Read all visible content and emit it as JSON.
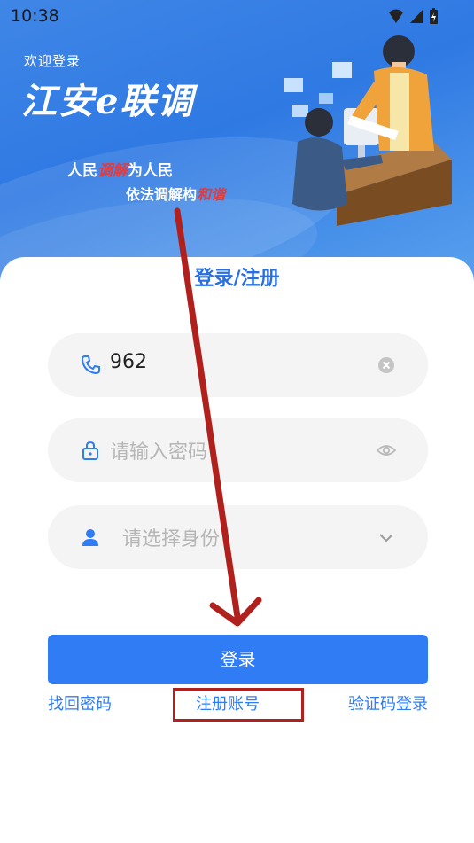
{
  "status_bar": {
    "time": "10:38"
  },
  "header": {
    "welcome": "欢迎登录",
    "app_name": "江安e联调",
    "slogan_line1_part1": "人民",
    "slogan_line1_highlight": "调解",
    "slogan_line1_part2": "为人民",
    "slogan_line2_part1": "依法调解构",
    "slogan_line2_highlight": "和谐"
  },
  "form": {
    "title": "登录/注册",
    "phone": {
      "value": "962"
    },
    "password": {
      "placeholder": "请输入密码"
    },
    "identity": {
      "placeholder": "请选择身份"
    },
    "login_button": "登录",
    "links": {
      "forgot_password": "找回密码",
      "register": "注册账号",
      "sms_login": "验证码登录"
    }
  },
  "colors": {
    "primary": "#2f7cf5",
    "header_bg": "#3f86e6",
    "annotation_red": "#b0211d"
  },
  "icons": [
    "wifi-icon",
    "signal-icon",
    "battery-icon",
    "phone-icon",
    "clear-icon",
    "lock-icon",
    "eye-icon",
    "user-icon",
    "chevron-down-icon"
  ]
}
